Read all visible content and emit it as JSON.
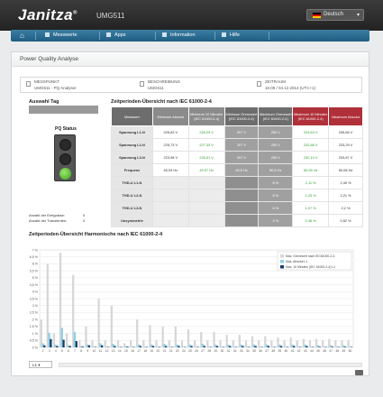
{
  "header": {
    "brand": "Janitza",
    "brand_mark": "®",
    "model": "UMG511",
    "language": "Deutsch"
  },
  "nav": {
    "items": [
      "Messwerte",
      "Apps",
      "Information",
      "Hilfe"
    ]
  },
  "page": {
    "title": "Power Quality Analyse"
  },
  "info": {
    "messpunkt_label": "MESSPUNKT",
    "messpunkt_value": "UMG511 - PQ Analyser",
    "beschreibung_label": "BESCHREIBUNG",
    "beschreibung_value": "UMG511",
    "zeitraum_label": "ZEITRAUM",
    "zeitraum_value": "10.09 / 04.12.2014 (UTC+1)"
  },
  "left": {
    "auswahl_label": "Auswahl Tag",
    "pq_status_label": "PQ Status",
    "ereignisse_label": "Anzahl der Ereignisse:",
    "ereignisse_value": "0",
    "transienten_label": "Anzahl der Transienten:",
    "transienten_value": "0"
  },
  "table": {
    "title": "Zeitperioden-Übersicht nach IEC 61000-2-4",
    "headers": [
      "Messwert",
      "Minimum Absolut",
      "Minimum 10 Minuten (IEC 61000-2-4)",
      "Minimum Grenzwert (IEC 61000-2-4)",
      "Maximum Grenzwert (IEC 61000-2-4)",
      "Maximum 10 Minuten (IEC 61000-2-4)",
      "Maximum Absolut"
    ],
    "rows": [
      [
        "Spannung L1-N",
        "226,83 V",
        "228,29 V",
        "207 V",
        "253 V",
        "233,63 V",
        "235,66 V"
      ],
      [
        "Spannung L2-N",
        "225,73 V",
        "227,33 V",
        "207 V",
        "253 V",
        "232,88 V",
        "233,29 V"
      ],
      [
        "Spannung L3-N",
        "223,98 V",
        "226,51 V",
        "207 V",
        "253 V",
        "232,10 V",
        "233,67 V"
      ],
      [
        "Frequenz",
        "49,93 Hz",
        "49,97 Hz",
        "49,5 Hz",
        "50,5 Hz",
        "50,05 Hz",
        "50,08 Hz"
      ],
      [
        "THD-U L1-N",
        "",
        "",
        "",
        "8 %",
        "2,11 %",
        "2,49 %"
      ],
      [
        "THD-U L2-N",
        "",
        "",
        "",
        "8 %",
        "1,33 %",
        "2,21 %"
      ],
      [
        "THD-U L3-N",
        "",
        "",
        "",
        "8 %",
        "1,07 %",
        "2,2 %"
      ],
      [
        "Unsymmetrie",
        "",
        "",
        "",
        "2 %",
        "0,38 %",
        "0,52 %"
      ]
    ]
  },
  "chart_title": "Zeitperioden-Übersicht Harmonische nach IEC 61000-2-4",
  "chart_data": {
    "type": "bar",
    "categories": [
      "2",
      "3",
      "4",
      "5",
      "6",
      "7",
      "8",
      "9",
      "10",
      "11",
      "12",
      "13",
      "14",
      "15",
      "16",
      "17",
      "18",
      "19",
      "20",
      "21",
      "22",
      "23",
      "24",
      "25",
      "26",
      "27",
      "28",
      "29",
      "30",
      "31",
      "32",
      "33",
      "34",
      "35",
      "36",
      "37",
      "38",
      "39",
      "40",
      "41",
      "42",
      "43",
      "44",
      "45",
      "46",
      "47",
      "48",
      "49",
      "50"
    ],
    "series": [
      {
        "name": "Max. Grenzwert nach IEC61000-2-4",
        "color": "#d6d6d6",
        "values": [
          2,
          6,
          1,
          6.8,
          1,
          5.2,
          0.5,
          1.5,
          0.5,
          3.5,
          0.5,
          3,
          0.5,
          0.3,
          0.5,
          2,
          0.5,
          1.6,
          0.5,
          1.5,
          0.5,
          1.5,
          0.5,
          1.3,
          0.5,
          1.1,
          0.5,
          1.1,
          0.5,
          0.9,
          0.5,
          0.9,
          0.5,
          0.8,
          0.5,
          0.8,
          0.5,
          0.7,
          0.5,
          0.7,
          0.5,
          0.6,
          0.5,
          0.6,
          0.5,
          0.6,
          0.5,
          0.5,
          0.5
        ]
      },
      {
        "name": "Max. Absolut L1",
        "color": "#8ecfe6",
        "values": [
          0.3,
          1.05,
          0.2,
          1.4,
          0.15,
          1.1,
          0.1,
          0.2,
          0.05,
          0.3,
          0.05,
          0.25,
          0.05,
          0.1,
          0.05,
          0.2,
          0.05,
          0.2,
          0.05,
          0.25,
          0.05,
          0.2,
          0.05,
          0.2,
          0.05,
          0.25,
          0.05,
          0.2,
          0.05,
          0.2,
          0.05,
          0.2,
          0.05,
          0.2,
          0.05,
          0.2,
          0.05,
          0.2,
          0.05,
          0.2,
          0.05,
          0.2,
          0.05,
          0.15,
          0.05,
          0.15,
          0.05,
          0.15,
          0.05
        ]
      },
      {
        "name": "Max. 10 Minuten (IEC 61000-2-4) L1",
        "color": "#153b6a",
        "values": [
          0.15,
          0.6,
          0.1,
          0.55,
          0.1,
          0.45,
          0.05,
          0.15,
          0.03,
          0.15,
          0.03,
          0.1,
          0.03,
          0.05,
          0.03,
          0.1,
          0.03,
          0.1,
          0.03,
          0.1,
          0.03,
          0.1,
          0.03,
          0.1,
          0.03,
          0.1,
          0.03,
          0.1,
          0.03,
          0.1,
          0.03,
          0.1,
          0.03,
          0.1,
          0.03,
          0.1,
          0.03,
          0.1,
          0.03,
          0.1,
          0.03,
          0.1,
          0.03,
          0.05,
          0.03,
          0.05,
          0.03,
          0.05,
          0.03
        ]
      }
    ],
    "yticks": [
      "0 %",
      "0,5 %",
      "1 %",
      "1,5 %",
      "2 %",
      "2,5 %",
      "3 %",
      "3,5 %",
      "4 %",
      "4,5 %",
      "5 %",
      "5,5 %",
      "6 %",
      "6,5 %",
      "7 %"
    ],
    "ylim": [
      0,
      7
    ],
    "legend": "top-right",
    "grid": true
  },
  "chart_selector": {
    "value": "L1"
  }
}
